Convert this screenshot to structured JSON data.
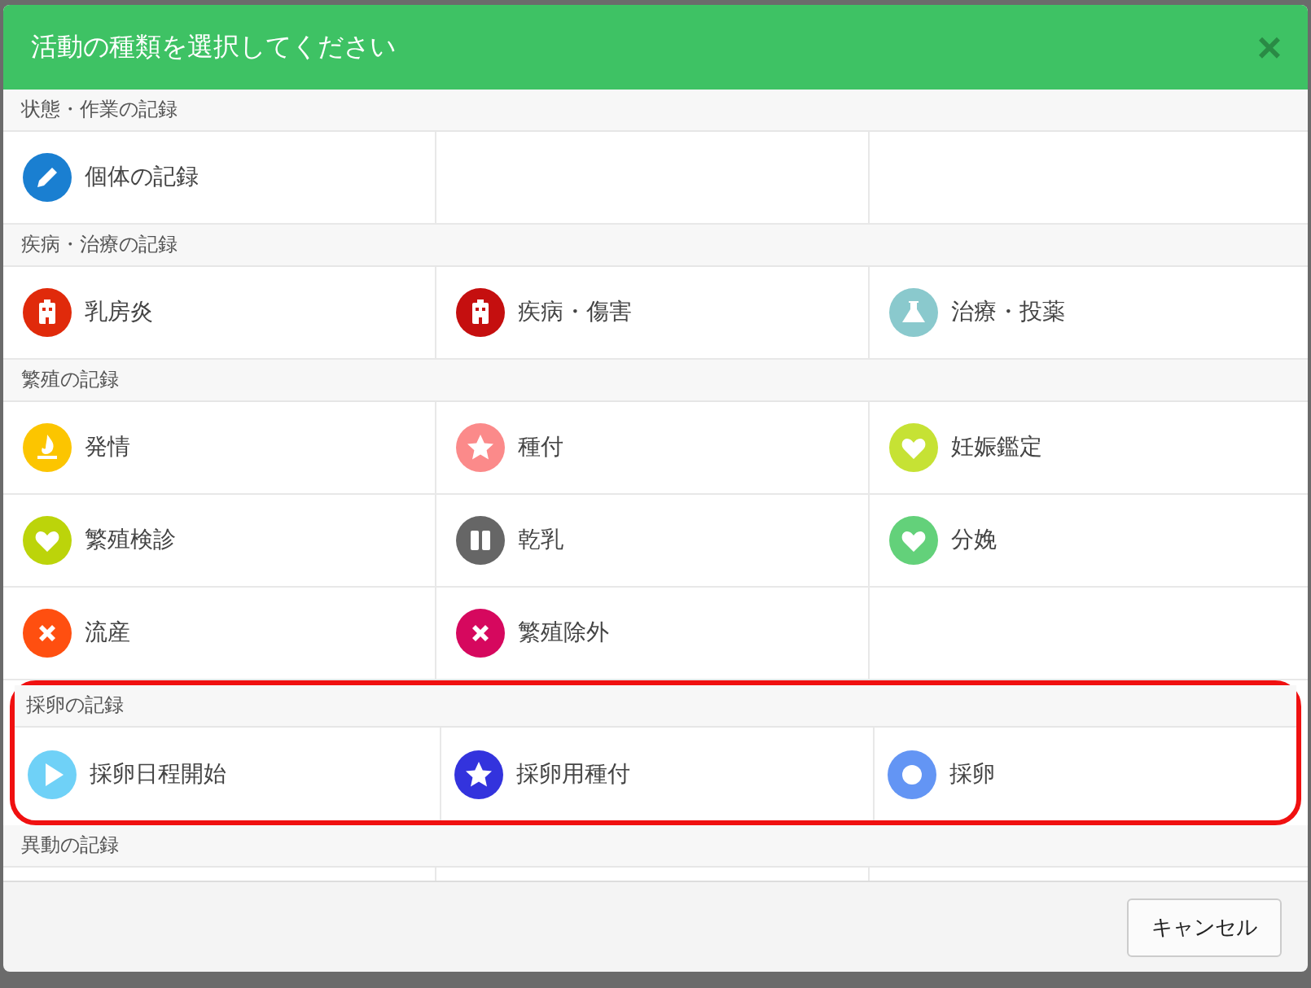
{
  "dialog": {
    "title": "活動の種類を選択してください",
    "close": "×"
  },
  "sections": [
    {
      "title": "状態・作業の記録",
      "highlighted": false,
      "items": [
        {
          "label": "個体の記録",
          "kind": "pencil",
          "color": "#1a7fd1"
        }
      ]
    },
    {
      "title": "疾病・治療の記録",
      "highlighted": false,
      "items": [
        {
          "label": "乳房炎",
          "kind": "hospital",
          "color": "#e02a0b"
        },
        {
          "label": "疾病・傷害",
          "kind": "hospital",
          "color": "#c50f0f"
        },
        {
          "label": "治療・投薬",
          "kind": "flask",
          "color": "#8ac9cd"
        }
      ]
    },
    {
      "title": "繁殖の記録",
      "highlighted": false,
      "items": [
        {
          "label": "発情",
          "kind": "flame",
          "color": "#fcc500"
        },
        {
          "label": "種付",
          "kind": "star",
          "color": "#fb8a8a"
        },
        {
          "label": "妊娠鑑定",
          "kind": "heart",
          "color": "#c6e234"
        },
        {
          "label": "繁殖検診",
          "kind": "heart",
          "color": "#bcd40a"
        },
        {
          "label": "乾乳",
          "kind": "pause",
          "color": "#666666"
        },
        {
          "label": "分娩",
          "kind": "heart",
          "color": "#63d17a"
        },
        {
          "label": "流産",
          "kind": "cross",
          "color": "#ff4f10"
        },
        {
          "label": "繁殖除外",
          "kind": "cross",
          "color": "#d6085e"
        }
      ]
    },
    {
      "title": "採卵の記録",
      "highlighted": true,
      "items": [
        {
          "label": "採卵日程開始",
          "kind": "play",
          "color": "#6fd1f7"
        },
        {
          "label": "採卵用種付",
          "kind": "star",
          "color": "#3333dd"
        },
        {
          "label": "採卵",
          "kind": "circle",
          "color": "#6395f4"
        }
      ]
    },
    {
      "title": "異動の記録",
      "highlighted": false
    }
  ],
  "buttons": [
    {
      "label": "キャンセル"
    }
  ]
}
